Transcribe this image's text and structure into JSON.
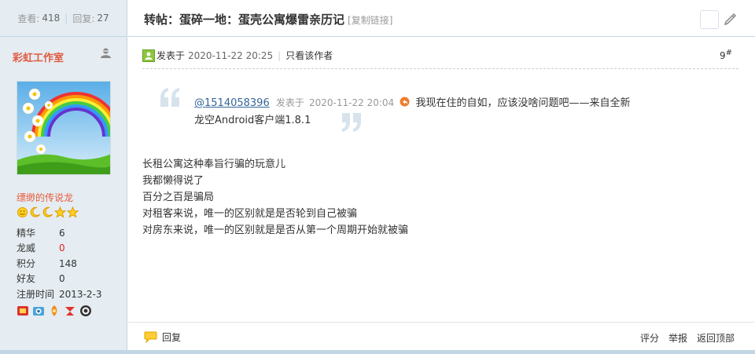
{
  "stats": {
    "views_label": "查看:",
    "views": "418",
    "replies_label": "回复:",
    "replies": "27"
  },
  "thread": {
    "title": "转帖：蛋碎一地：蛋壳公寓爆雷亲历记",
    "copy_link": "[复制链接]"
  },
  "author": {
    "name": "彩虹工作室",
    "group": "缥缈的传说龙",
    "info": [
      {
        "key": "精华",
        "value": "6"
      },
      {
        "key": "龙威",
        "value": "0"
      },
      {
        "key": "积分",
        "value": "148"
      },
      {
        "key": "好友",
        "value": "0"
      },
      {
        "key": "注册时间",
        "value": "2013-2-3"
      }
    ],
    "stars_icons": [
      "sun-icon",
      "moon-icon",
      "moon-icon",
      "star-icon",
      "star-icon"
    ],
    "medal_icons": [
      "medal-1-icon",
      "medal-2-icon",
      "medal-3-icon",
      "medal-4-icon",
      "medal-5-icon"
    ]
  },
  "post": {
    "posted_label": "发表于",
    "date": "2020-11-22 20:25",
    "only_author": "只看该作者",
    "floor": "9",
    "floor_sup": "#",
    "quote": {
      "user": "@1514058396",
      "posted_label": "发表于",
      "date": "2020-11-22 20:04",
      "text": "我现在住的自如，应该没啥问题吧——来自全新龙空Android客户端1.8.1"
    },
    "message_lines": [
      "长租公寓这种奉旨行骗的玩意儿",
      "我都懒得说了",
      "百分之百是骗局",
      "对租客来说，唯一的区别就是是否轮到自己被骗",
      "对房东来说，唯一的区别就是是否从第一个周期开始就被骗"
    ]
  },
  "footer": {
    "reply": "回复",
    "rate": "评分",
    "report": "举报",
    "top": "返回顶部"
  },
  "colors": {
    "sidebar_bg": "#e5edf2",
    "border": "#c2d5e3",
    "author_name": "#e05a40",
    "link": "#336699"
  }
}
